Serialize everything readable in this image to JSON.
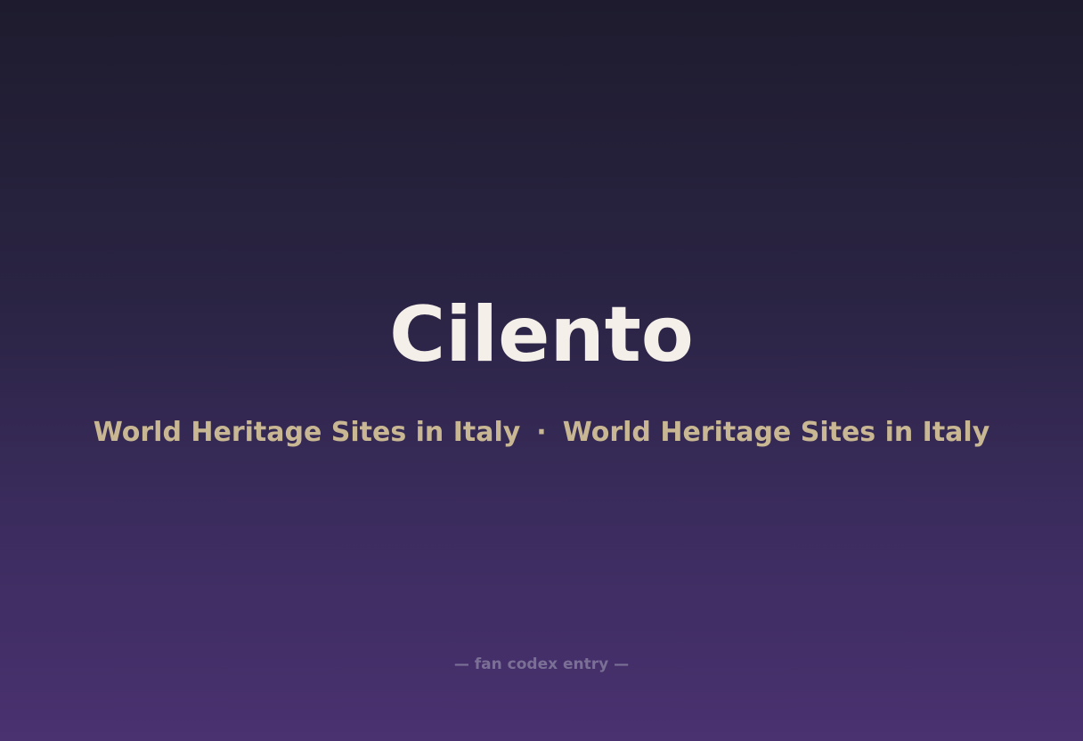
{
  "title": "Cilento",
  "subtitle": {
    "part1": "World Heritage Sites in Italy",
    "separator": "·",
    "part2": "World Heritage Sites in Italy"
  },
  "footer": "— fan codex entry —",
  "colors": {
    "title": "#f4efe9",
    "subtitle": "#c8b792",
    "footer": "#7a6f95",
    "background_top": "#1e1b2e",
    "background_bottom": "#4a3170"
  }
}
